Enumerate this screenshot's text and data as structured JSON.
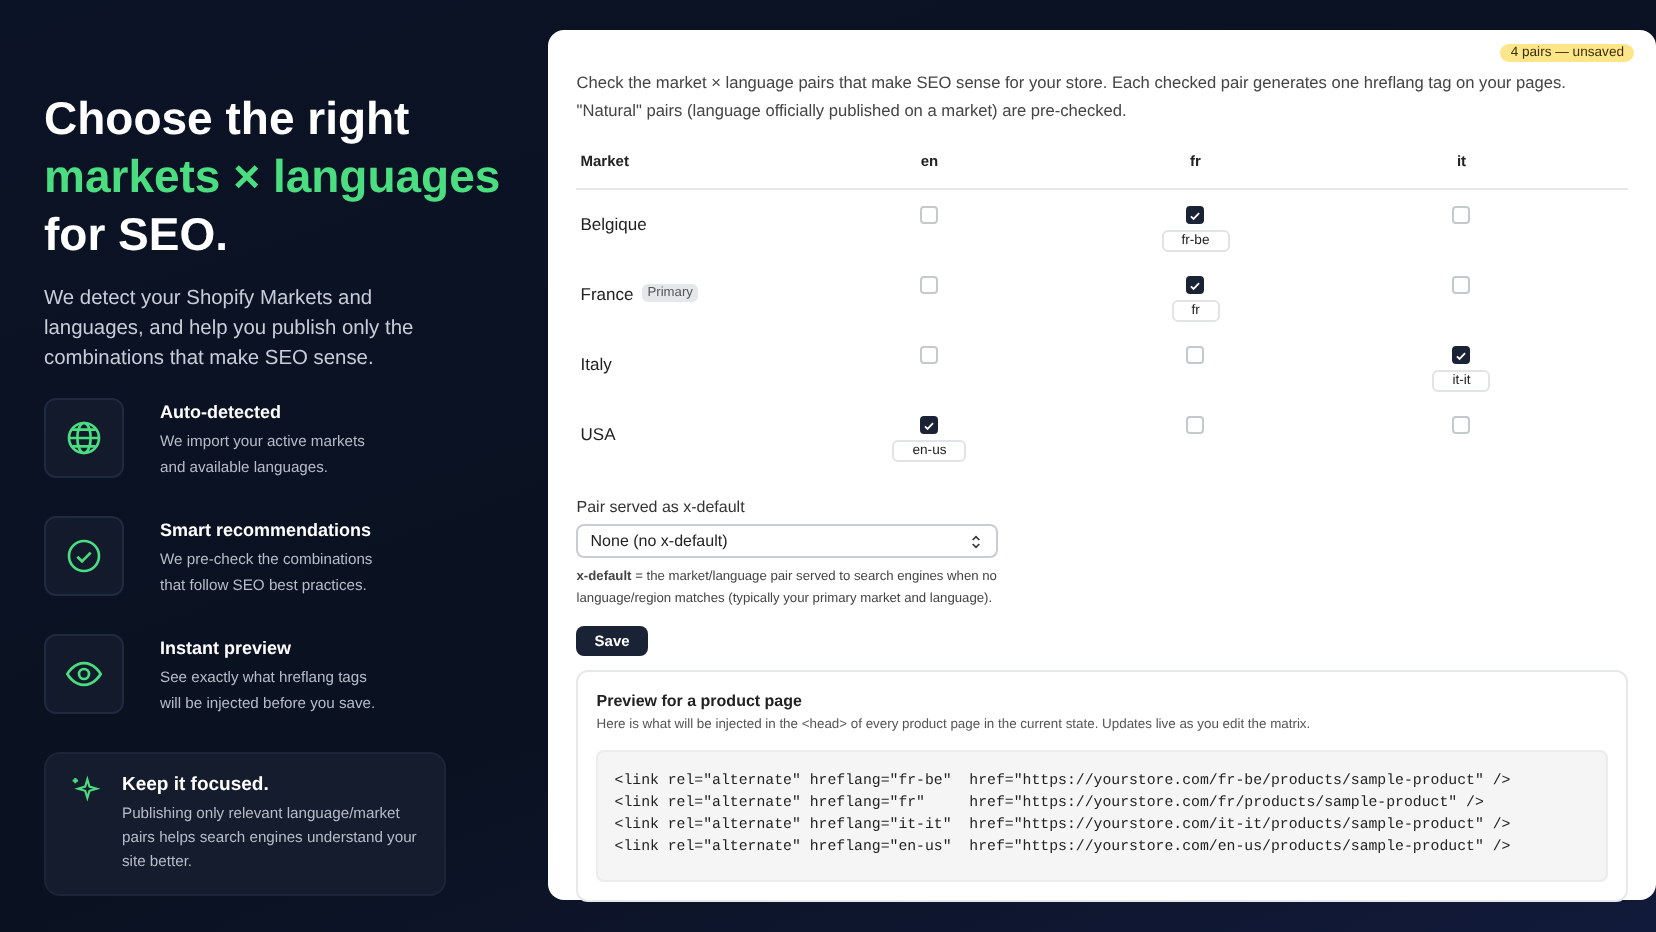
{
  "hero": {
    "title_lines": [
      {
        "text": "Choose the right",
        "accent": false
      },
      {
        "text": "markets × languages",
        "accent": true
      },
      {
        "text": "for SEO.",
        "accent": false
      }
    ],
    "description": "We detect your Shopify Markets and languages, and help you publish only the combinations that make SEO sense."
  },
  "features": [
    {
      "title": "Auto-detected",
      "text": "We import your active markets and available languages."
    },
    {
      "title": "Smart recommendations",
      "text": "We pre-check the combinations that follow SEO best practices."
    },
    {
      "title": "Instant preview",
      "text": "See exactly what hreflang tags will be injected before you save."
    }
  ],
  "tip": {
    "title": "Keep it focused.",
    "text": "Publishing only relevant language/market pairs helps search engines understand your site better."
  },
  "panel": {
    "badge": "4 pairs — unsaved",
    "intro": "Check the market × language pairs that make SEO sense for your store. Each checked pair generates one hreflang tag on your pages. \"Natural\" pairs (language officially published on a market) are pre-checked.",
    "market_header": "Market",
    "language_columns": [
      "en",
      "fr",
      "it"
    ],
    "rows": [
      {
        "market": "Belgique",
        "cells": [
          {
            "checked": false
          },
          {
            "checked": true,
            "tag": "fr-be"
          },
          {
            "checked": false
          }
        ]
      },
      {
        "market": "France",
        "badge": "Primary",
        "cells": [
          {
            "checked": false
          },
          {
            "checked": true,
            "tag": "fr"
          },
          {
            "checked": false
          }
        ]
      },
      {
        "market": "Italy",
        "cells": [
          {
            "checked": false
          },
          {
            "checked": false
          },
          {
            "checked": true,
            "tag": "it-it"
          }
        ]
      },
      {
        "market": "USA",
        "cells": [
          {
            "checked": true,
            "tag": "en-us"
          },
          {
            "checked": false
          },
          {
            "checked": false
          }
        ]
      }
    ],
    "x_default": {
      "label": "Pair served as x-default",
      "value": "None (no x-default)",
      "hint": "**x-default** = the market/language pair served to search engines when no language/region matches (typically your primary market and language)."
    },
    "save_button": "Save",
    "preview": {
      "title": "Preview for a product page",
      "text": "Here is what will be injected in the <head> of every product page in the current state. Updates live as you edit the matrix.",
      "code_lines": [
        "<link rel=\"alternate\" hreflang=\"fr-be\"  href=\"https://yourstore.com/fr-be/products/sample-product\" />",
        "<link rel=\"alternate\" hreflang=\"fr\"     href=\"https://yourstore.com/fr/products/sample-product\" />",
        "<link rel=\"alternate\" hreflang=\"it-it\"  href=\"https://yourstore.com/it-it/products/sample-product\" />",
        "<link rel=\"alternate\" hreflang=\"en-us\"  href=\"https://yourstore.com/en-us/products/sample-product\" />"
      ]
    }
  }
}
